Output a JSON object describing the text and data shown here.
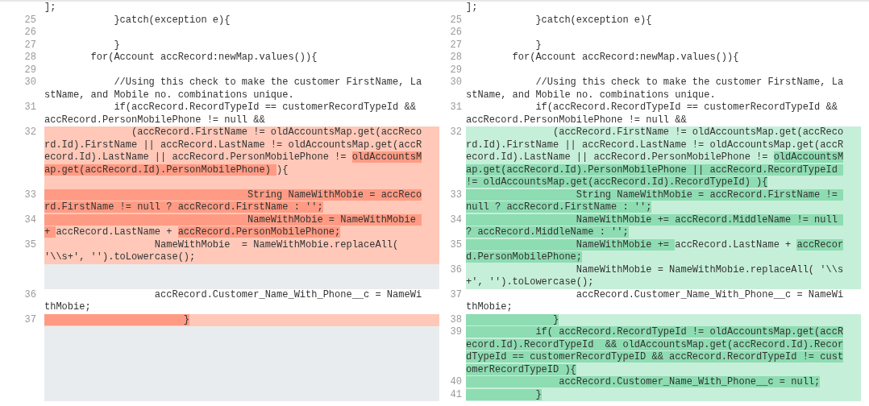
{
  "rows": [
    {
      "left": {
        "kind": "context",
        "lines": [
          [
            {
              "text": "];"
            }
          ]
        ]
      },
      "right": {
        "kind": "context",
        "lines": [
          [
            {
              "text": "];"
            }
          ]
        ]
      }
    },
    {
      "left": {
        "number": "25",
        "kind": "context",
        "lines": [
          [
            {
              "text": "            }catch(exception e){"
            }
          ]
        ]
      },
      "right": {
        "number": "25",
        "kind": "context",
        "lines": [
          [
            {
              "text": "            }catch(exception e){"
            }
          ]
        ]
      }
    },
    {
      "left": {
        "number": "26",
        "kind": "context"
      },
      "right": {
        "number": "26",
        "kind": "context"
      }
    },
    {
      "left": {
        "number": "27",
        "kind": "context",
        "lines": [
          [
            {
              "text": "            }"
            }
          ]
        ]
      },
      "right": {
        "number": "27",
        "kind": "context",
        "lines": [
          [
            {
              "text": "            }"
            }
          ]
        ]
      }
    },
    {
      "left": {
        "number": "28",
        "kind": "context",
        "lines": [
          [
            {
              "text": "        for(Account accRecord:newMap.values()){"
            }
          ]
        ]
      },
      "right": {
        "number": "28",
        "kind": "context",
        "lines": [
          [
            {
              "text": "        for(Account accRecord:newMap.values()){"
            }
          ]
        ]
      }
    },
    {
      "left": {
        "number": "29",
        "kind": "context"
      },
      "right": {
        "number": "29",
        "kind": "context"
      }
    },
    {
      "left": {
        "number": "30",
        "kind": "context",
        "lines": [
          [
            {
              "text": "            //Using this check to make the customer FirstName, La"
            }
          ],
          [
            {
              "text": "stName, and Mobile no. combinations unique."
            }
          ]
        ]
      },
      "right": {
        "number": "30",
        "kind": "context",
        "lines": [
          [
            {
              "text": "            //Using this check to make the customer FirstName, La"
            }
          ],
          [
            {
              "text": "stName, and Mobile no. combinations unique."
            }
          ]
        ]
      }
    },
    {
      "left": {
        "number": "31",
        "kind": "context",
        "lines": [
          [
            {
              "text": "            if(accRecord.RecordTypeId == customerRecordTypeId &&"
            }
          ],
          [
            {
              "text": "accRecord.PersonMobilePhone != null &&"
            }
          ]
        ]
      },
      "right": {
        "number": "31",
        "kind": "context",
        "lines": [
          [
            {
              "text": "            if(accRecord.RecordTypeId == customerRecordTypeId &&"
            }
          ],
          [
            {
              "text": "accRecord.PersonMobilePhone != null &&"
            }
          ]
        ]
      }
    },
    {
      "left": {
        "number": "32",
        "kind": "removed",
        "lines": [
          [
            {
              "text": "               (accRecord.FirstName != oldAccountsMap.get(accReco",
              "changed": false
            }
          ],
          [
            {
              "text": "rd.Id).FirstName || accRecord.LastName != oldAccountsMap.get(accR",
              "changed": false
            }
          ],
          [
            {
              "text": "ecord.Id).LastName || accRecord.PersonMobilePhone != ",
              "changed": false
            },
            {
              "text": "oldAccountsM",
              "changed": true
            }
          ],
          [
            {
              "text": "ap.get(accRecord.Id).PersonMobilePhone) ",
              "changed": true
            },
            {
              "text": "){",
              "changed": false
            }
          ]
        ]
      },
      "right": {
        "number": "32",
        "kind": "added",
        "lines": [
          [
            {
              "text": "               (accRecord.FirstName != oldAccountsMap.get(accReco",
              "changed": false
            }
          ],
          [
            {
              "text": "rd.Id).FirstName || accRecord.LastName != oldAccountsMap.get(accR",
              "changed": false
            }
          ],
          [
            {
              "text": "ecord.Id).LastName || accRecord.PersonMobilePhone != ",
              "changed": false
            },
            {
              "text": "oldAccountsM",
              "changed": true
            }
          ],
          [
            {
              "text": "ap.get(accRecord.Id).PersonMobilePhone || accRecord.RecordTypeId ",
              "changed": true
            }
          ],
          [
            {
              "text": "!= oldAccountsMap.get(accRecord.Id).RecordTypeId) ){",
              "changed": true
            }
          ]
        ]
      }
    },
    {
      "left": {
        "number": "33",
        "kind": "removed",
        "lines": [
          [
            {
              "text": "                                   String NameWithMobie = accReco",
              "changed": true
            }
          ],
          [
            {
              "text": "rd.FirstName != null ? accRecord.FirstName : '';",
              "changed": true
            }
          ]
        ]
      },
      "right": {
        "number": "33",
        "kind": "added",
        "lines": [
          [
            {
              "text": "                   String NameWithMobie = accRecord.FirstName != ",
              "changed": true
            }
          ],
          [
            {
              "text": "null ? accRecord.FirstName : '';",
              "changed": true
            }
          ]
        ]
      }
    },
    {
      "left": {
        "number": "34",
        "kind": "removed",
        "lines": [
          [
            {
              "text": "                                   NameWithMobie = NameWithMobie ",
              "changed": true
            }
          ],
          [
            {
              "text": "+ ",
              "changed": true
            },
            {
              "text": "accRecord.LastName + ",
              "changed": false
            },
            {
              "text": "accRecord.PersonMobilePhone;",
              "changed": true
            }
          ]
        ]
      },
      "right": {
        "number": "34",
        "kind": "added",
        "lines": [
          [
            {
              "text": "                   NameWithMobie += accRecord.MiddleName != null ",
              "changed": true
            }
          ],
          [
            {
              "text": "? accRecord.MiddleName : '';",
              "changed": true
            }
          ]
        ]
      }
    },
    {
      "left": {
        "number": "35",
        "kind": "removed",
        "lines": [
          [
            {
              "text": "                   NameWithMobie  = NameWithMobie.replaceAll(",
              "changed": false
            }
          ],
          [
            {
              "text": "'\\\\s+', '').toLowercase();",
              "changed": false
            }
          ]
        ]
      },
      "right": {
        "number": "35",
        "kind": "added",
        "lines": [
          [
            {
              "text": "                   NameWithMobie += ",
              "changed": true
            },
            {
              "text": "accRecord.LastName + ",
              "changed": false
            },
            {
              "text": "accRecor",
              "changed": true
            }
          ],
          [
            {
              "text": "d.PersonMobilePhone;",
              "changed": true
            }
          ]
        ]
      }
    },
    {
      "right": {
        "number": "36",
        "kind": "added",
        "lines": [
          [
            {
              "text": "                   NameWithMobie = NameWithMobie.replaceAll( '\\\\s",
              "changed": false
            }
          ],
          [
            {
              "text": "+', '').toLowercase();",
              "changed": false
            }
          ]
        ]
      }
    },
    {
      "left": {
        "number": "36",
        "kind": "context",
        "lines": [
          [
            {
              "text": "                   accRecord.Customer_Name_With_Phone__c = NameWi"
            }
          ],
          [
            {
              "text": "thMobie;"
            }
          ]
        ]
      },
      "right": {
        "number": "37",
        "kind": "context",
        "lines": [
          [
            {
              "text": "                   accRecord.Customer_Name_With_Phone__c = NameWi"
            }
          ],
          [
            {
              "text": "thMobie;"
            }
          ]
        ]
      }
    },
    {
      "left": {
        "number": "37",
        "kind": "removed",
        "lines": [
          [
            {
              "text": "                        }",
              "changed": true
            }
          ]
        ]
      },
      "right": {
        "number": "38",
        "kind": "added",
        "lines": [
          [
            {
              "text": "               }",
              "changed": true
            }
          ]
        ]
      }
    },
    {
      "right": {
        "number": "39",
        "kind": "added",
        "lines": [
          [
            {
              "text": "            if( accRecord.RecordTypeId != oldAccountsMap.get(accR",
              "changed": true
            }
          ],
          [
            {
              "text": "ecord.Id).RecordTypeId  && oldAccountsMap.get(accRecord.Id).Recor",
              "changed": true
            }
          ],
          [
            {
              "text": "dTypeId == customerRecordTypeID && accRecord.RecordTypeId != cust",
              "changed": true
            }
          ],
          [
            {
              "text": "omerRecordTypeID ){",
              "changed": true
            }
          ]
        ]
      }
    },
    {
      "right": {
        "number": "40",
        "kind": "added",
        "lines": [
          [
            {
              "text": "                accRecord.Customer_Name_With_Phone__c = null;",
              "changed": true
            }
          ]
        ]
      }
    },
    {
      "right": {
        "number": "41",
        "kind": "added",
        "lines": [
          [
            {
              "text": "            }",
              "changed": true
            }
          ]
        ]
      }
    }
  ]
}
